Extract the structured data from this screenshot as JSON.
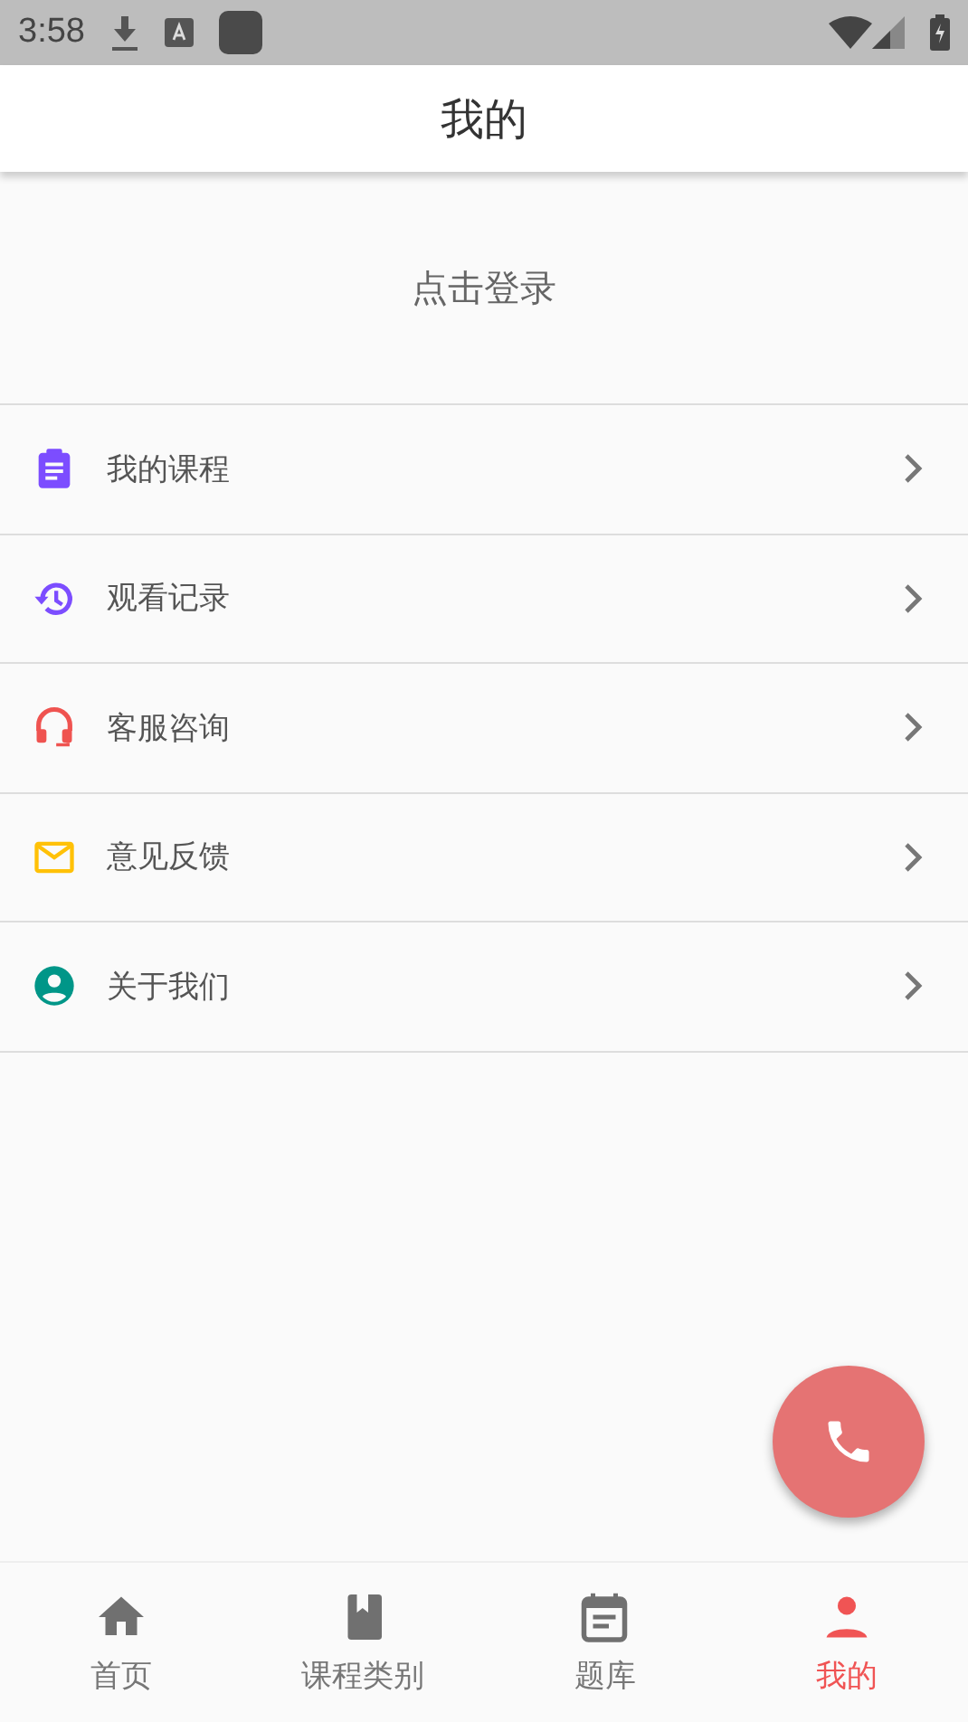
{
  "status_bar": {
    "time": "3:58"
  },
  "app_bar": {
    "title": "我的"
  },
  "login": {
    "label": "点击登录"
  },
  "menu": [
    {
      "label": "我的课程",
      "color": "#7c4dff"
    },
    {
      "label": "观看记录",
      "color": "#7c4dff"
    },
    {
      "label": "客服咨询",
      "color": "#ef5350"
    },
    {
      "label": "意见反馈",
      "color": "#ffc107"
    },
    {
      "label": "关于我们",
      "color": "#009688"
    }
  ],
  "bottom_nav": [
    {
      "label": "首页",
      "selected": false
    },
    {
      "label": "课程类别",
      "selected": false
    },
    {
      "label": "题库",
      "selected": false
    },
    {
      "label": "我的",
      "selected": true
    }
  ]
}
